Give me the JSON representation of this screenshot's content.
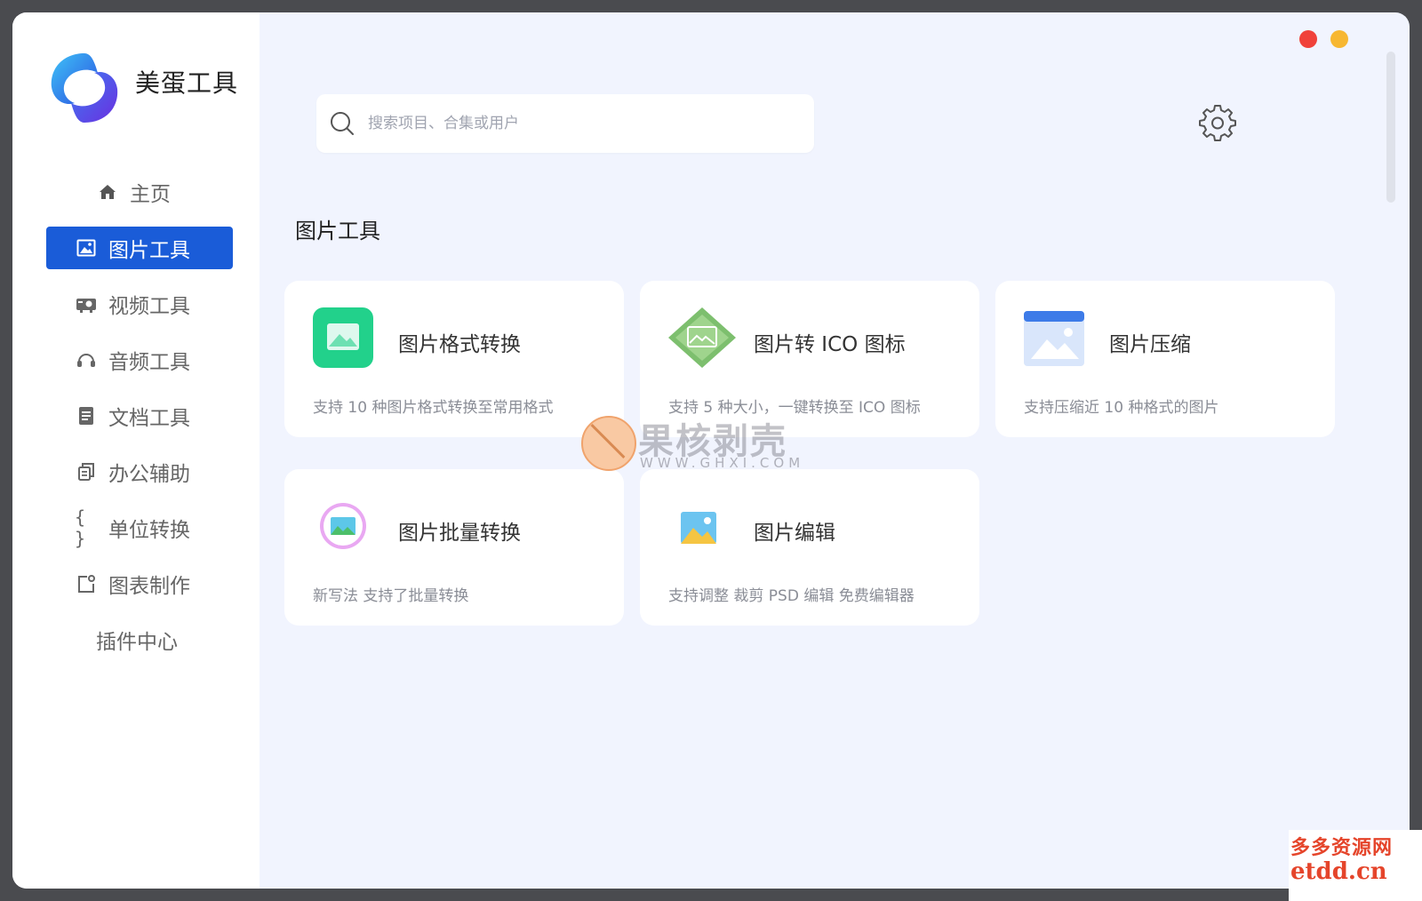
{
  "app": {
    "title": "美蛋工具"
  },
  "sidebar": {
    "items": [
      {
        "label": "主页",
        "icon": "home-icon"
      },
      {
        "label": "图片工具",
        "icon": "image-icon",
        "active": true
      },
      {
        "label": "视频工具",
        "icon": "video-icon"
      },
      {
        "label": "音频工具",
        "icon": "headset-icon"
      },
      {
        "label": "文档工具",
        "icon": "document-icon"
      },
      {
        "label": "办公辅助",
        "icon": "copy-icon"
      },
      {
        "label": "单位转换",
        "icon": "braces-icon"
      },
      {
        "label": "图表制作",
        "icon": "chart-edit-icon"
      },
      {
        "label": "插件中心"
      }
    ]
  },
  "search": {
    "placeholder": "搜索项目、合集或用户",
    "value": ""
  },
  "section": {
    "title": "图片工具"
  },
  "cards": [
    {
      "title": "图片格式转换",
      "desc": "支持 10 种图片格式转换至常用格式",
      "icon": "image-convert-icon"
    },
    {
      "title": "图片转 ICO 图标",
      "desc": "支持 5 种大小，一键转换至 ICO 图标",
      "icon": "image-to-ico-icon"
    },
    {
      "title": "图片压缩",
      "desc": "支持压缩近 10 种格式的图片",
      "icon": "image-compress-icon"
    },
    {
      "title": "图片批量转换",
      "desc": "新写法 支持了批量转换",
      "icon": "image-batch-icon"
    },
    {
      "title": "图片编辑",
      "desc": "支持调整 裁剪 PSD 编辑  免费编辑器",
      "icon": "image-edit-icon"
    }
  ],
  "watermarks": {
    "center_text": "果核剥壳",
    "center_sub": "WWW.GHXI.COM",
    "corner_top": "多多资源网",
    "corner_bottom": "etdd.cn"
  },
  "colors": {
    "accent": "#1a5cd8",
    "background": "#f1f4fe",
    "close_dot": "#f0413a",
    "minimize_dot": "#f7b731"
  }
}
